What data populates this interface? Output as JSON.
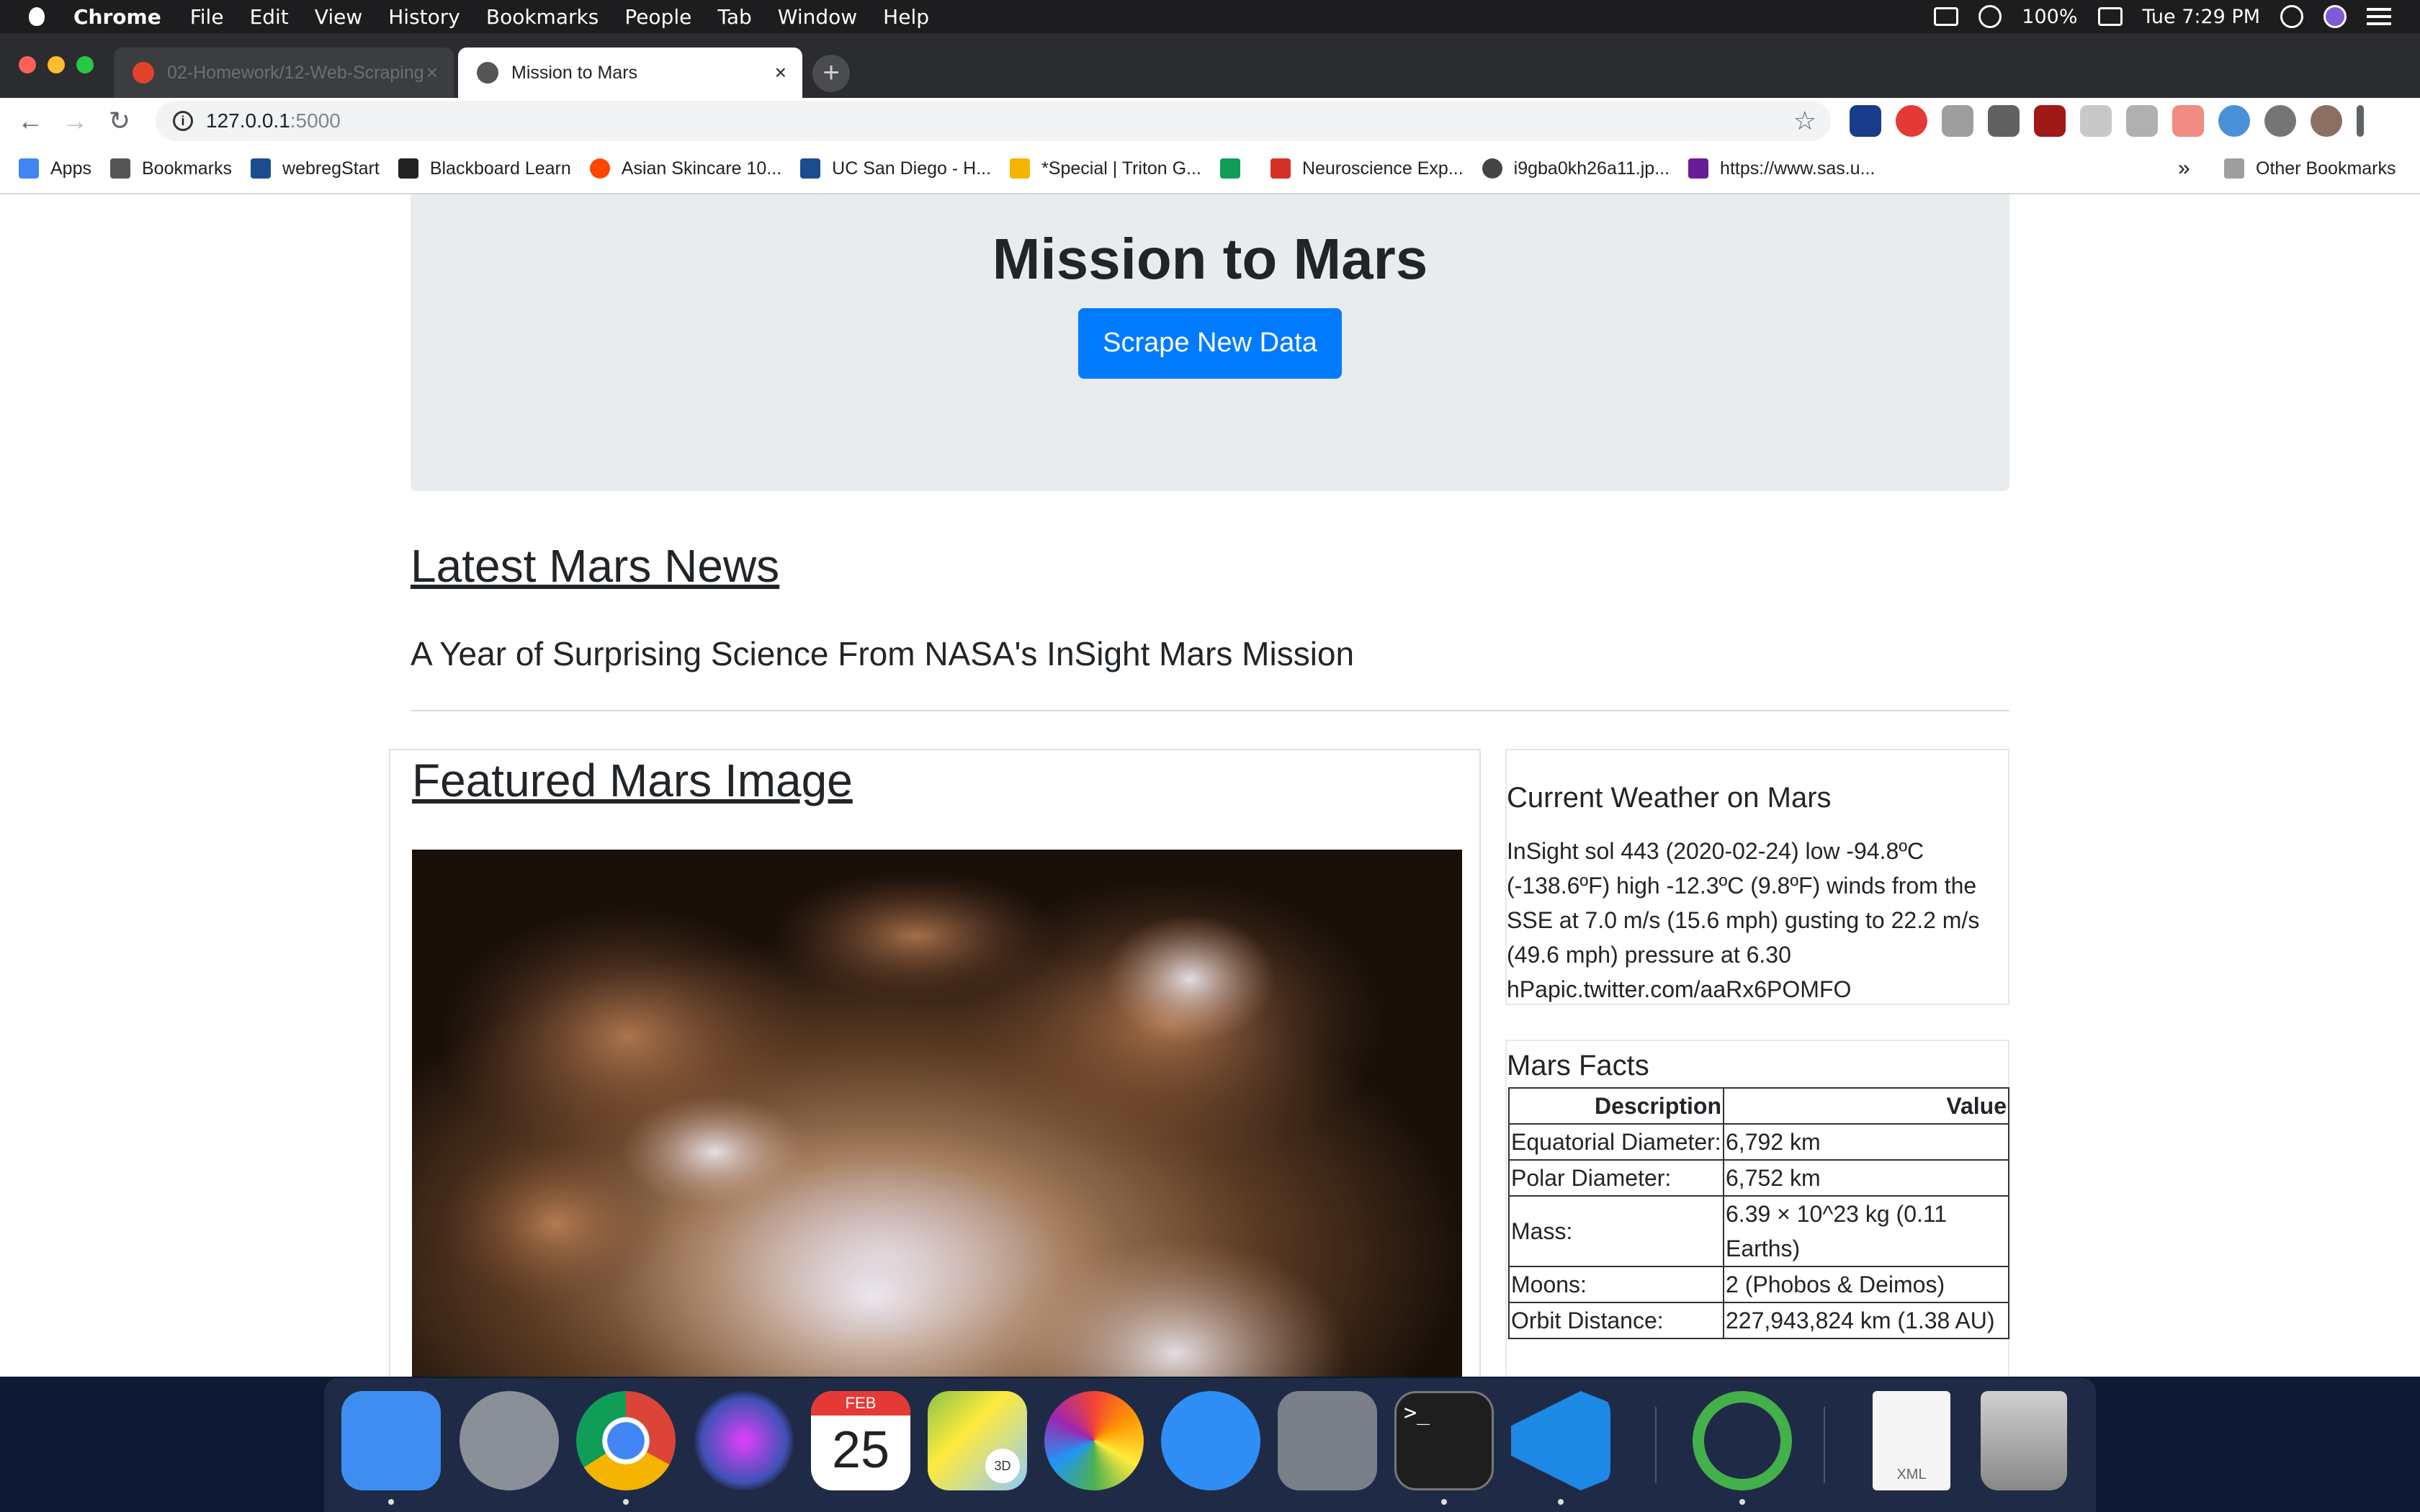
{
  "menubar": {
    "app_name": "Chrome",
    "menus": [
      "File",
      "Edit",
      "View",
      "History",
      "Bookmarks",
      "People",
      "Tab",
      "Window",
      "Help"
    ],
    "battery": "100%",
    "clock": "Tue 7:29 PM"
  },
  "tabs": [
    {
      "title": "02-Homework/12-Web-Scraping",
      "favicon_color": "#e2432a"
    },
    {
      "title": "Mission to Mars",
      "favicon_color": "#555555"
    }
  ],
  "tab_close_glyph": "×",
  "new_tab_glyph": "+",
  "address": {
    "host": "127.0.0.1",
    "port": ":5000"
  },
  "bookmarks": [
    {
      "label": "Apps",
      "icon": "apps-icon",
      "color": "#4285f4"
    },
    {
      "label": "Bookmarks",
      "icon": "star-icon",
      "color": "#555555"
    },
    {
      "label": "webregStart",
      "icon": "triton-icon",
      "color": "#1a4d8f"
    },
    {
      "label": "Blackboard Learn",
      "icon": "blackboard-icon",
      "color": "#222222"
    },
    {
      "label": "Asian Skincare 10...",
      "icon": "reddit-icon",
      "color": "#ff4500"
    },
    {
      "label": "UC San Diego - H...",
      "icon": "triton-icon",
      "color": "#1a4d8f"
    },
    {
      "label": "*Special | Triton G...",
      "icon": "drive-icon",
      "color": "#f4b400"
    },
    {
      "label": "",
      "icon": "drive-icon",
      "color": "#0f9d58"
    },
    {
      "label": "Neuroscience Exp...",
      "icon": "pdf-icon",
      "color": "#d93025"
    },
    {
      "label": "i9gba0kh26a11.jp...",
      "icon": "globe-icon",
      "color": "#444444"
    },
    {
      "label": "https://www.sas.u...",
      "icon": "sas-icon",
      "color": "#6a1b9a"
    }
  ],
  "bookmarks_overflow": "»",
  "other_bookmarks": "Other Bookmarks",
  "page": {
    "title": "Mission to Mars",
    "scrape_button": "Scrape New Data",
    "news_heading": "Latest Mars News",
    "news_title": "A Year of Surprising Science From NASA's InSight Mars Mission",
    "featured_heading": "Featured Mars Image",
    "weather_heading": "Current Weather on Mars",
    "weather_text": "InSight sol 443 (2020-02-24) low -94.8ºC (-138.6ºF) high -12.3ºC (9.8ºF) winds from the SSE at 7.0 m/s (15.6 mph) gusting to 22.2 m/s (49.6 mph) pressure at 6.30 hPapic.twitter.com/aaRx6POMFO",
    "facts_heading": "Mars Facts",
    "facts_columns": [
      "Description",
      "Value"
    ],
    "facts_rows": [
      [
        "Equatorial Diameter:",
        "6,792 km"
      ],
      [
        "Polar Diameter:",
        "6,752 km"
      ],
      [
        "Mass:",
        "6.39 × 10^23 kg (0.11 Earths)"
      ],
      [
        "Moons:",
        "2 (Phobos & Deimos)"
      ],
      [
        "Orbit Distance:",
        "227,943,824 km (1.38 AU)"
      ]
    ]
  },
  "dock": {
    "calendar_month": "FEB",
    "calendar_day": "25",
    "maps_badge": "3D",
    "file_label": "XML",
    "apps": [
      "Finder",
      "Launchpad",
      "Google Chrome",
      "Siri",
      "Calendar",
      "Maps",
      "Photos",
      "Messages",
      "System Preferences",
      "Terminal",
      "Visual Studio Code",
      "Anaconda",
      "XML File",
      "Trash"
    ]
  },
  "colors": {
    "primary": "#007bff",
    "jumbotron": "#e9ecef"
  }
}
